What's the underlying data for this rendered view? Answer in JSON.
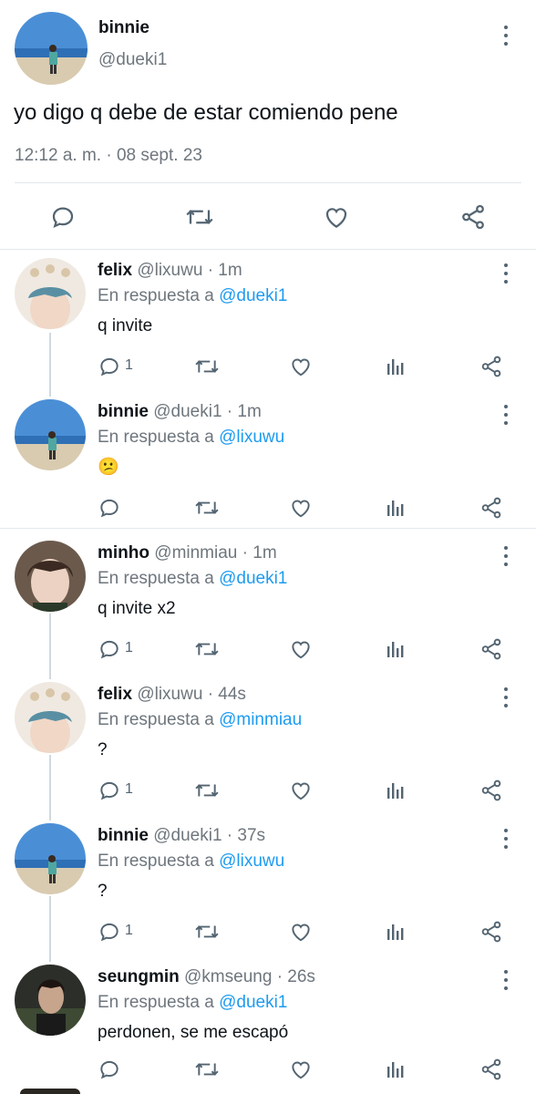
{
  "main_tweet": {
    "name": "binnie",
    "handle": "@dueki1",
    "text": "yo digo q debe de estar comiendo pene",
    "timestamp": "12:12 a. m. · 08 sept. 23"
  },
  "replies": [
    {
      "name": "felix",
      "handle": "@lixuwu",
      "time": "· 1m",
      "reply_prefix": "En respuesta a",
      "reply_to": "@dueki1",
      "text": "q invite",
      "reply_count": "1"
    },
    {
      "name": "binnie",
      "handle": "@dueki1",
      "time": "· 1m",
      "reply_prefix": "En respuesta a",
      "reply_to": "@lixuwu",
      "text": "😕",
      "reply_count": ""
    },
    {
      "name": "minho",
      "handle": "@minmiau",
      "time": "· 1m",
      "reply_prefix": "En respuesta a",
      "reply_to": "@dueki1",
      "text": "q invite x2",
      "reply_count": "1"
    },
    {
      "name": "felix",
      "handle": "@lixuwu",
      "time": "· 44s",
      "reply_prefix": "En respuesta a",
      "reply_to": "@minmiau",
      "text": "?",
      "reply_count": "1"
    },
    {
      "name": "binnie",
      "handle": "@dueki1",
      "time": "· 37s",
      "reply_prefix": "En respuesta a",
      "reply_to": "@lixuwu",
      "text": "?",
      "reply_count": "1"
    },
    {
      "name": "seungmin",
      "handle": "@kmseung",
      "time": "· 26s",
      "reply_prefix": "En respuesta a",
      "reply_to": "@dueki1",
      "text": "perdonen, se me escapó",
      "reply_count": ""
    }
  ],
  "colors": {
    "accent": "#1d9bf0",
    "text": "#0f1419",
    "muted": "#6e767d"
  }
}
